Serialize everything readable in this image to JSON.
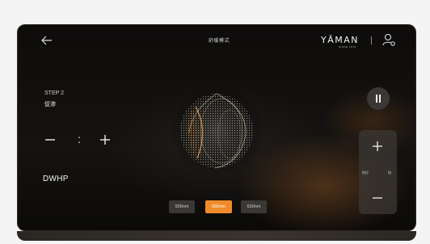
{
  "header": {
    "title": "舒缓模式",
    "brand": "YĀMAN",
    "brand_sub": "SINCE 1978",
    "back_icon": "arrow-left-icon",
    "profile_icon": "user-settings-icon"
  },
  "step": {
    "label": "STEP 2",
    "name": "促渗"
  },
  "timer": {
    "separator": ":",
    "minus_icon": "minus-icon",
    "plus_icon": "plus-icon"
  },
  "mode": {
    "label": "DWHP"
  },
  "controls": {
    "pause_icon": "pause-icon",
    "intensity": {
      "plus_icon": "plus-icon",
      "minus_icon": "minus-icon",
      "label_left": "档位",
      "label_right": "档"
    }
  },
  "wavelengths": {
    "options": [
      "505nm",
      "590nm",
      "630nm"
    ],
    "selected": "590nm"
  },
  "colors": {
    "accent": "#f08b2c",
    "background": "#0d0c0b",
    "panel": "#3a3835"
  }
}
